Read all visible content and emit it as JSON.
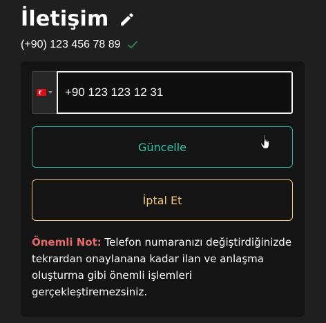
{
  "header": {
    "title": "İletişim",
    "edit_icon": "pencil-icon",
    "phone_display": "(+90) 123 456 78 89",
    "verified_icon": "check-icon",
    "verified_color": "#2e8b57"
  },
  "form": {
    "country_flag": "turkey-flag-icon",
    "phone_value": "+90 123 123 12 31",
    "update_label": "Güncelle",
    "update_color": "#2fc6a9",
    "cancel_label": "İptal Et",
    "cancel_color": "#f2c477"
  },
  "note": {
    "label": "Önemli Not:",
    "text": " Telefon numaranızı değiştirdiğinizde tekrardan onaylanana kadar ilan ve anlaşma oluşturma gibi önemli işlemleri gerçekleştiremezsiniz.",
    "label_color": "#e86b6b"
  },
  "cursor": "hand-pointer-icon"
}
